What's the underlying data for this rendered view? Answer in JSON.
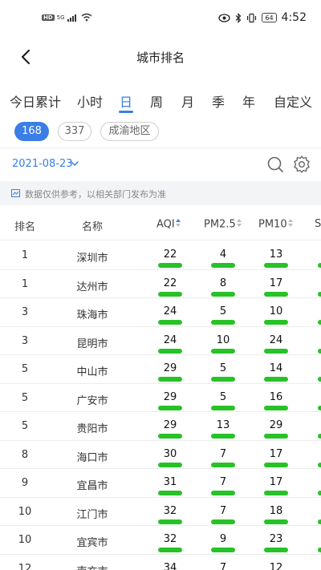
{
  "status_bar": {
    "hd": "HD",
    "network": "5G",
    "battery": "64",
    "time": "4:52"
  },
  "nav": {
    "title": "城市排名"
  },
  "tabs": [
    "今日累计",
    "小时",
    "日",
    "周",
    "月",
    "季",
    "年",
    "自定义"
  ],
  "active_tab": "日",
  "chips": [
    "168",
    "337",
    "成渝地区"
  ],
  "active_chip": "168",
  "date": "2021-08-23",
  "notice": "数据仅供参考，以相关部门发布为准",
  "table": {
    "headers": {
      "rank": "排名",
      "name": "名称",
      "aqi": "AQI",
      "pm25": "PM2.5",
      "pm10": "PM10",
      "partial": "S"
    },
    "sort_arrow": "▲▼",
    "rows": [
      {
        "rank": "1",
        "name": "深圳市",
        "aqi": "22",
        "pm25": "4",
        "pm10": "13"
      },
      {
        "rank": "1",
        "name": "达州市",
        "aqi": "22",
        "pm25": "8",
        "pm10": "17"
      },
      {
        "rank": "3",
        "name": "珠海市",
        "aqi": "24",
        "pm25": "5",
        "pm10": "10"
      },
      {
        "rank": "3",
        "name": "昆明市",
        "aqi": "24",
        "pm25": "10",
        "pm10": "24"
      },
      {
        "rank": "5",
        "name": "中山市",
        "aqi": "29",
        "pm25": "5",
        "pm10": "14"
      },
      {
        "rank": "5",
        "name": "广安市",
        "aqi": "29",
        "pm25": "5",
        "pm10": "16"
      },
      {
        "rank": "5",
        "name": "贵阳市",
        "aqi": "29",
        "pm25": "13",
        "pm10": "29"
      },
      {
        "rank": "8",
        "name": "海口市",
        "aqi": "30",
        "pm25": "7",
        "pm10": "17"
      },
      {
        "rank": "9",
        "name": "宜昌市",
        "aqi": "31",
        "pm25": "7",
        "pm10": "17"
      },
      {
        "rank": "10",
        "name": "江门市",
        "aqi": "32",
        "pm25": "7",
        "pm10": "18"
      },
      {
        "rank": "10",
        "name": "宜宾市",
        "aqi": "32",
        "pm25": "9",
        "pm10": "23"
      },
      {
        "rank": "12",
        "name": "南充市",
        "aqi": "34",
        "pm25": "7",
        "pm10": "12"
      }
    ]
  },
  "colors": {
    "accent": "#3a7ee6",
    "good_level": "#27c227"
  }
}
